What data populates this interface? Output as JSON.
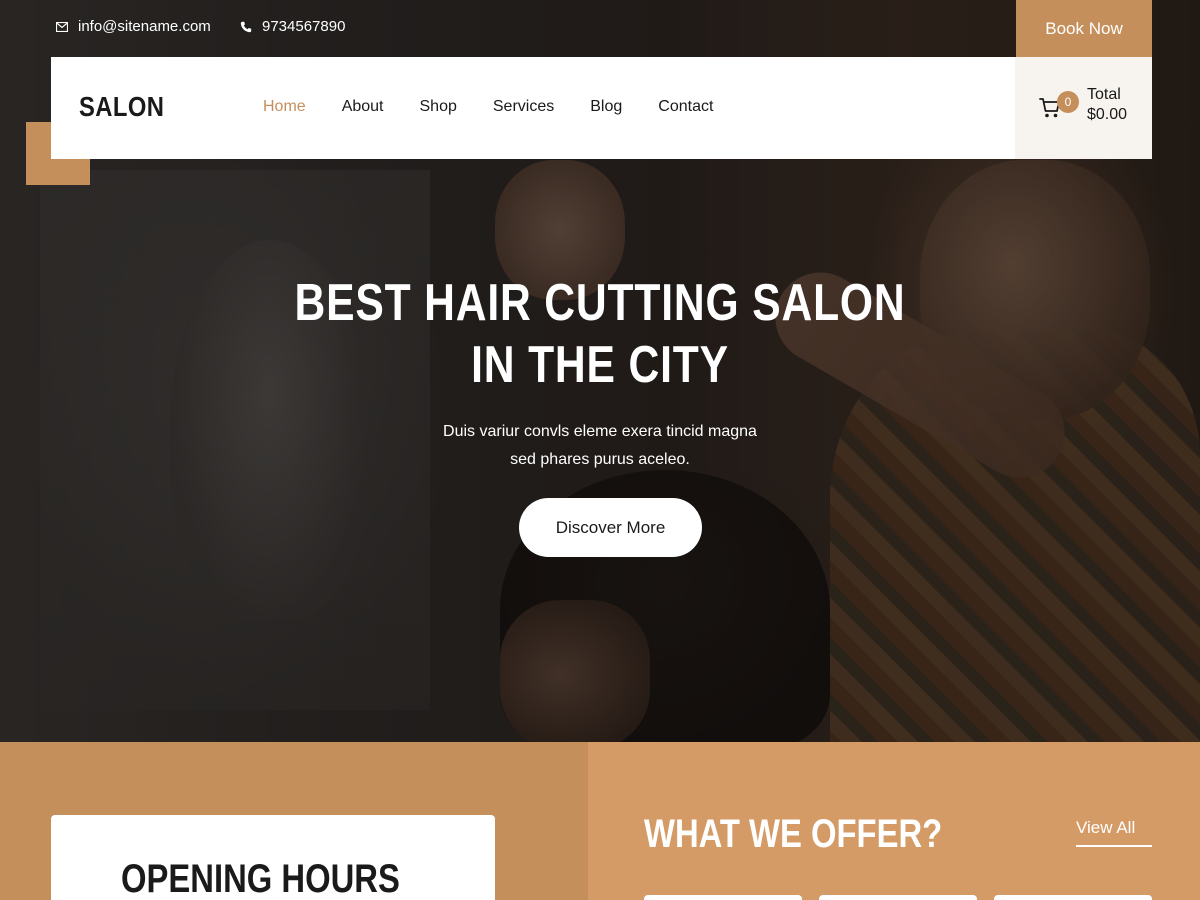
{
  "topbar": {
    "email": "info@sitename.com",
    "phone": "9734567890",
    "book_label": "Book Now",
    "email_icon": "envelope-icon",
    "phone_icon": "phone-icon"
  },
  "header": {
    "logo": "SALON",
    "nav": [
      {
        "label": "Home",
        "active": true
      },
      {
        "label": "About",
        "active": false
      },
      {
        "label": "Shop",
        "active": false
      },
      {
        "label": "Services",
        "active": false
      },
      {
        "label": "Blog",
        "active": false
      },
      {
        "label": "Contact",
        "active": false
      }
    ],
    "cart": {
      "count": "0",
      "total_label": "Total",
      "total_value": "$0.00",
      "icon": "cart-icon"
    }
  },
  "hero": {
    "title_line1": "BEST HAIR CUTTING SALON",
    "title_line2": "IN THE CITY",
    "subtitle_line1": "Duis variur convls eleme exera tincid magna",
    "subtitle_line2": "sed phares purus aceleo.",
    "cta_label": "Discover More"
  },
  "sections": {
    "hours_title": "OPENING HOURS",
    "offer_title": "WHAT WE OFFER?",
    "view_all_label": "View All"
  },
  "colors": {
    "accent": "#c58f5c",
    "accent_light": "#d59b66",
    "text_dark": "#1a1a1a",
    "white": "#ffffff"
  }
}
